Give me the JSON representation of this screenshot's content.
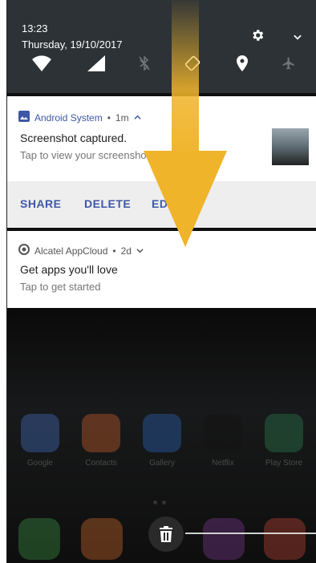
{
  "status": {
    "time": "13:23",
    "date": "Thursday, 19/10/2017"
  },
  "notifications": [
    {
      "app": "Android System",
      "age": "1m",
      "title": "Screenshot captured.",
      "text": "Tap to view your screenshot.",
      "actions": [
        "SHARE",
        "DELETE",
        "EDIT"
      ]
    },
    {
      "app": "Alcatel AppCloud",
      "age": "2d",
      "title": "Get apps you'll love",
      "text": "Tap to get started"
    }
  ],
  "home_apps": [
    "Google",
    "Contacts",
    "Gallery",
    "Netflix",
    "Play Store"
  ],
  "colors": {
    "panel": "#2c3236",
    "accent": "#3d57a6",
    "arrow": "#f0b42a"
  }
}
